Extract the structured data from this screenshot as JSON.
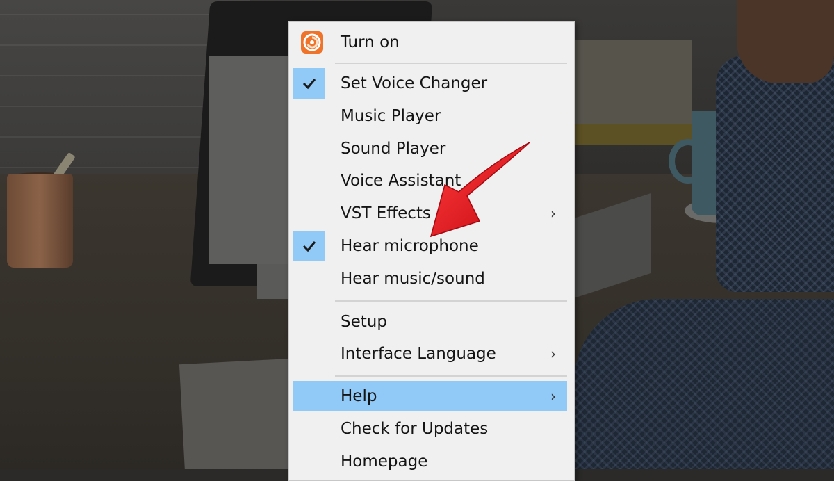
{
  "menu": {
    "items": [
      {
        "label": "Turn on",
        "has_icon": true
      },
      {
        "label": "Set Voice Changer",
        "checked": true
      },
      {
        "label": "Music Player"
      },
      {
        "label": "Sound Player"
      },
      {
        "label": "Voice Assistant"
      },
      {
        "label": "VST Effects",
        "submenu": true
      },
      {
        "label": "Hear microphone",
        "checked": true
      },
      {
        "label": "Hear music/sound"
      },
      {
        "label": "Setup"
      },
      {
        "label": "Interface Language",
        "submenu": true
      },
      {
        "label": "Help",
        "submenu": true,
        "highlighted": true
      },
      {
        "label": "Check for Updates"
      },
      {
        "label": "Homepage"
      }
    ],
    "submenu_glyph": "›",
    "check_glyph": "✓"
  },
  "colors": {
    "menu_bg": "#f0f0f0",
    "highlight": "#91c9f7",
    "app_icon": "#f0732a",
    "annotation_arrow": "#e8101a"
  },
  "icons": {
    "app": "voice-changer-app-icon",
    "check": "checkmark-icon",
    "submenu": "chevron-right-icon",
    "annotation": "red-pointer-arrow-icon"
  }
}
